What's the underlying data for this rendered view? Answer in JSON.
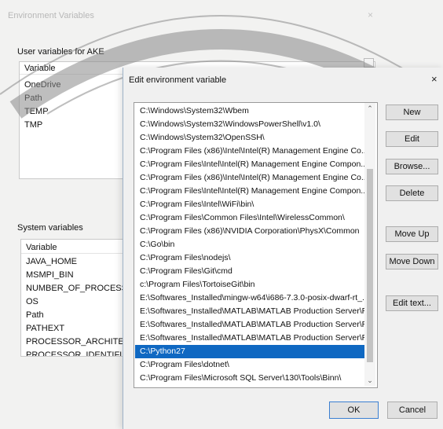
{
  "background_window": {
    "title": "Environment Variables",
    "close_glyph": "×",
    "user_section_label": "User variables for AKE",
    "user_header": "Variable",
    "user_variables": [
      "OneDrive",
      "Path",
      "TEMP",
      "TMP"
    ],
    "system_section_label": "System variables",
    "system_header": "Variable",
    "system_variables": [
      "JAVA_HOME",
      "MSMPI_BIN",
      "NUMBER_OF_PROCESSORS",
      "OS",
      "Path",
      "PATHEXT",
      "PROCESSOR_ARCHITECTU",
      "PROCESSOR_IDENTIFIER"
    ]
  },
  "dialog": {
    "title": "Edit environment variable",
    "close_glyph": "×",
    "paths": [
      "C:\\Windows\\System32\\Wbem",
      "C:\\Windows\\System32\\WindowsPowerShell\\v1.0\\",
      "C:\\Windows\\System32\\OpenSSH\\",
      "C:\\Program Files (x86)\\Intel\\Intel(R) Management Engine Co...",
      "C:\\Program Files\\Intel\\Intel(R) Management Engine Compon...",
      "C:\\Program Files (x86)\\Intel\\Intel(R) Management Engine Co...",
      "C:\\Program Files\\Intel\\Intel(R) Management Engine Compon...",
      "C:\\Program Files\\Intel\\WiFi\\bin\\",
      "C:\\Program Files\\Common Files\\Intel\\WirelessCommon\\",
      "C:\\Program Files (x86)\\NVIDIA Corporation\\PhysX\\Common",
      "C:\\Go\\bin",
      "C:\\Program Files\\nodejs\\",
      "C:\\Program Files\\Git\\cmd",
      "c:\\Program Files\\TortoiseGit\\bin",
      "E:\\Softwares_Installed\\mingw-w64\\i686-7.3.0-posix-dwarf-rt_...",
      "E:\\Softwares_Installed\\MATLAB\\MATLAB Production Server\\R...",
      "E:\\Softwares_Installed\\MATLAB\\MATLAB Production Server\\R...",
      "E:\\Softwares_Installed\\MATLAB\\MATLAB Production Server\\R...",
      "C:\\Python27",
      "C:\\Program Files\\dotnet\\",
      "C:\\Program Files\\Microsoft SQL Server\\130\\Tools\\Binn\\"
    ],
    "selected_path": "C:\\Python27",
    "buttons": {
      "new": "New",
      "edit": "Edit",
      "browse": "Browse...",
      "delete": "Delete",
      "move_up": "Move Up",
      "move_down": "Move Down",
      "edit_text": "Edit text...",
      "ok": "OK",
      "cancel": "Cancel"
    },
    "scroll_up_glyph": "⌃",
    "scroll_down_glyph": "⌄"
  },
  "colors": {
    "selection": "#0f68c2",
    "ok_border": "#3b7fd1",
    "watermark": "#7a7a7a"
  },
  "icons": [
    "close-icon",
    "chevron-up-icon",
    "chevron-down-icon",
    "watermark-seal"
  ]
}
